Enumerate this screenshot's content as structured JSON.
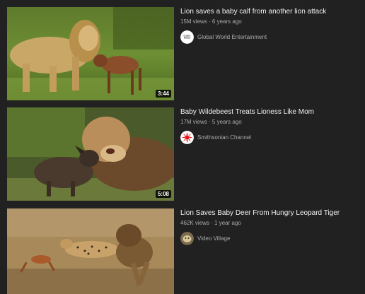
{
  "videos": [
    {
      "title": "Lion saves a baby calf from another lion attack",
      "views": "15M views",
      "age": "6 years ago",
      "duration": "3:44",
      "channel": "Global World Entertainment",
      "avatar_text": "GLOBAL WORLD"
    },
    {
      "title": "Baby Wildebeest Treats Lioness Like Mom",
      "views": "17M views",
      "age": "5 years ago",
      "duration": "5:08",
      "channel": "Smithsonian Channel"
    },
    {
      "title": "Lion Saves Baby Deer From Hungry Leopard Tiger",
      "views": "462K views",
      "age": "1 year ago",
      "channel": "Video Village"
    }
  ],
  "separator": " · ",
  "colors": {
    "background": "#212121",
    "title": "#f1f1f1",
    "secondary": "#aaaaaa",
    "smithsonian_red": "#e21b23"
  }
}
